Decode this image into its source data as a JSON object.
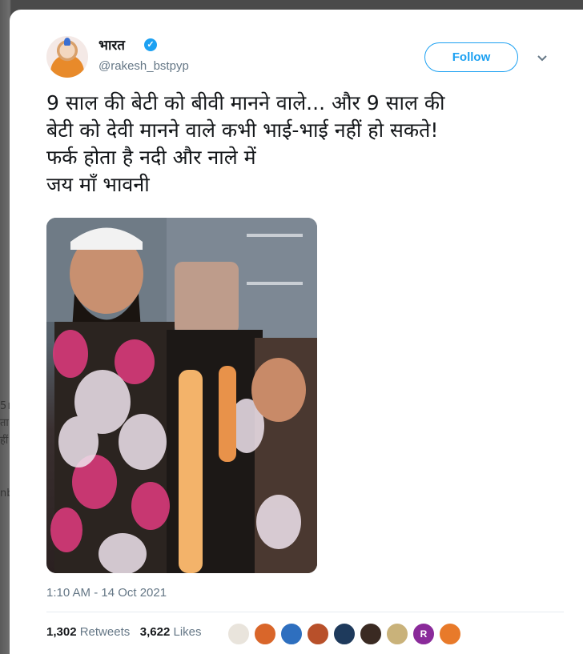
{
  "tweet": {
    "author_name": "भारत",
    "handle": "@rakesh_bstpyp",
    "follow_label": "Follow",
    "text_lines": [
      "9 साल की बेटी को बीवी मानने वाले... और 9 साल की",
      "बेटी को देवी मानने वाले कभी भाई-भाई नहीं हो सकते!",
      "फर्क होता है नदी और नाले में",
      "जय माँ भावनी"
    ],
    "timestamp": "1:10 AM - 14 Oct 2021",
    "retweets_count": "1,302",
    "retweets_label": "Retweets",
    "likes_count": "3,622",
    "likes_label": "Likes",
    "liker_initial": "R"
  },
  "background": {
    "fragments": [
      "5।",
      "ता",
      "हीं",
      "nb"
    ]
  },
  "colors": {
    "accent": "#1da1f2",
    "text": "#14171a",
    "muted": "#657786"
  },
  "icons": [
    "verified-badge-icon",
    "chevron-down-icon"
  ]
}
